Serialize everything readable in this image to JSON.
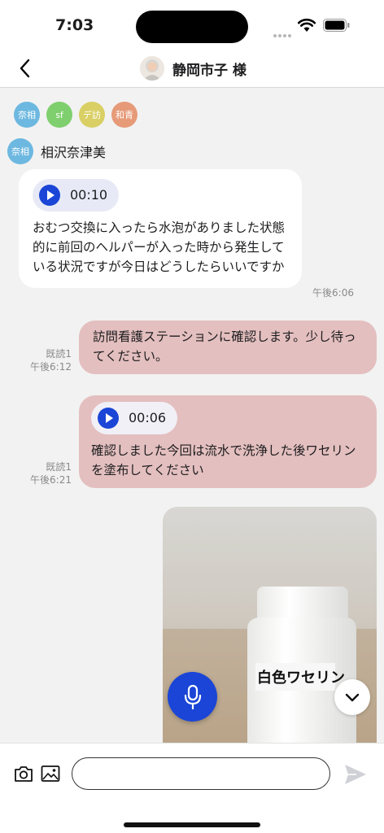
{
  "status": {
    "time": "7:03"
  },
  "nav": {
    "title": "静岡市子 様"
  },
  "tags": [
    {
      "label": "奈相",
      "color": "#6db8e0"
    },
    {
      "label": "sf",
      "color": "#7fcf6e"
    },
    {
      "label": "デ訪",
      "color": "#d9cf64"
    },
    {
      "label": "和青",
      "color": "#e69a78"
    }
  ],
  "sender": {
    "tag": "奈相",
    "tag_color": "#6db8e0",
    "name": "相沢奈津美"
  },
  "messages": [
    {
      "direction": "in",
      "duration": "00:10",
      "text": "おむつ交換に入ったら水泡がありました状態的に前回のヘルパーが入った時から発生している状況ですが今日はどうしたらいいですか",
      "time": "午後6:06"
    },
    {
      "direction": "out",
      "text": "訪問看護ステーションに確認します。少し待ってください。",
      "read": "既読1",
      "time": "午後6:12"
    },
    {
      "direction": "out",
      "duration": "00:06",
      "text": "確認しました今回は流水で洗浄した後ワセリンを塗布してください",
      "read": "既読1",
      "time": "午後6:21"
    }
  ],
  "photo": {
    "label_text": "白色ワセリン"
  },
  "input": {
    "placeholder": ""
  },
  "colors": {
    "accent": "#1a45d6",
    "outgoing_bubble": "#e4bfbf",
    "incoming_bubble": "#ffffff"
  }
}
